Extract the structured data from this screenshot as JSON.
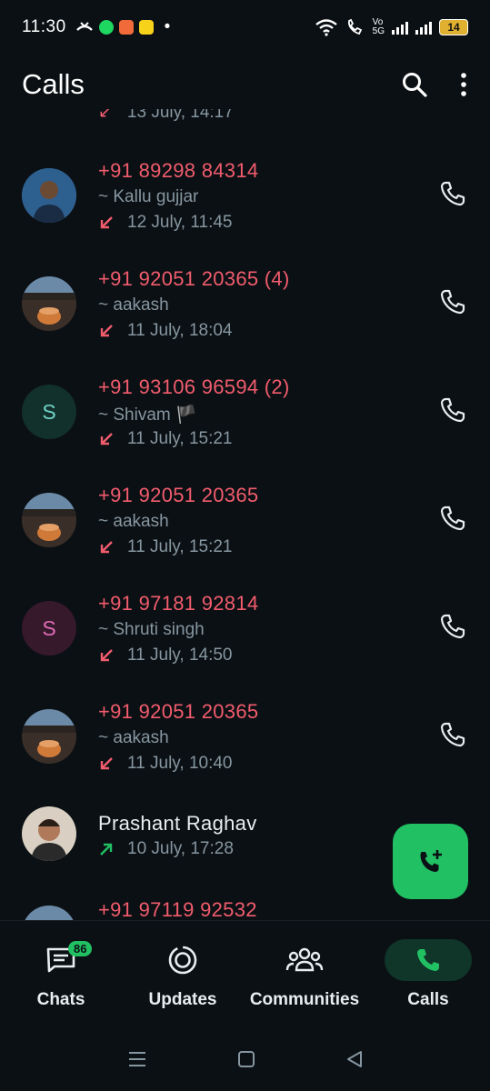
{
  "status_bar": {
    "time": "11:30",
    "dot": "•",
    "volte_label": "Vo\n5G",
    "battery": "14"
  },
  "header": {
    "title": "Calls",
    "search_icon": "search-icon",
    "menu_icon": "more-vertical-icon"
  },
  "calls": {
    "clipped_meta": "13 July, 14:17",
    "items": [
      {
        "number": "+91 89298 84314",
        "name": "~ Kallu gujjar",
        "meta": "12 July, 11:45",
        "direction": "missed",
        "avatar": "photo"
      },
      {
        "number": "+91 92051 20365 (4)",
        "name": "~ aakash",
        "meta": "11 July, 18:04",
        "direction": "missed",
        "avatar": "photo"
      },
      {
        "number": "+91 93106 96594 (2)",
        "name": "~ Shivam 🏴",
        "meta": "11 July, 15:21",
        "direction": "missed",
        "avatar_letter": "S",
        "avatar_color": "#6fd3c5",
        "avatar_bg": "#12302c"
      },
      {
        "number": "+91 92051 20365",
        "name": "~ aakash",
        "meta": "11 July, 15:21",
        "direction": "missed",
        "avatar": "photo"
      },
      {
        "number": "+91 97181 92814",
        "name": "~ Shruti singh",
        "meta": "11 July, 14:50",
        "direction": "missed",
        "avatar_letter": "S",
        "avatar_color": "#e06bb6",
        "avatar_bg": "#36192b"
      },
      {
        "number": "+91 92051 20365",
        "name": "~ aakash",
        "meta": "11 July, 10:40",
        "direction": "missed",
        "avatar": "photo"
      },
      {
        "number": "Prashant Raghav",
        "name": "",
        "meta": "10 July, 17:28",
        "direction": "outgoing",
        "avatar": "photo"
      },
      {
        "number": "+91 97119 92532",
        "name": "",
        "meta": "",
        "direction": "missed",
        "avatar": "photo"
      }
    ]
  },
  "fab": {
    "icon": "add-call-icon"
  },
  "bottom_nav": {
    "chats": {
      "label": "Chats",
      "badge": "86"
    },
    "updates": {
      "label": "Updates"
    },
    "communities": {
      "label": "Communities"
    },
    "calls": {
      "label": "Calls"
    }
  },
  "colors": {
    "missed": "#f15c6d",
    "outgoing": "#21c063",
    "accent": "#21c063",
    "background": "#0b1014"
  }
}
